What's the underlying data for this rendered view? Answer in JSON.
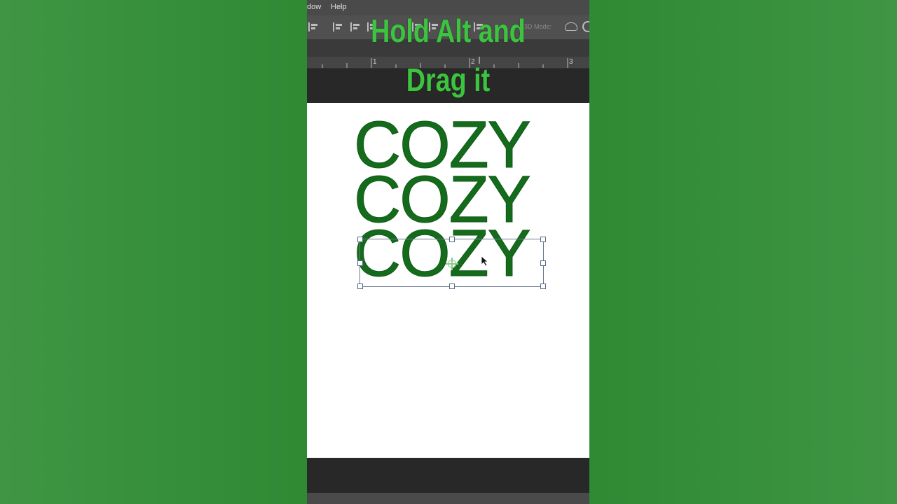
{
  "menubar": {
    "items": [
      "dow",
      "Help"
    ]
  },
  "optionsbar": {
    "mode_label": "3D Mode:"
  },
  "ruler": {
    "labels": [
      "1",
      "2",
      "3"
    ]
  },
  "canvas": {
    "lines": [
      "COZY",
      "COZY",
      "COZY"
    ]
  },
  "caption": {
    "line1": "Hold Alt and",
    "line2": "Drag it"
  },
  "colors": {
    "background_green": "#348c38",
    "text_green": "#156b1c",
    "caption_green": "#3cc43e"
  }
}
